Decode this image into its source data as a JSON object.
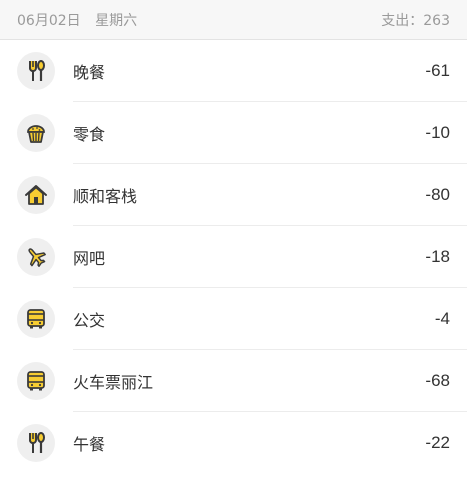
{
  "header": {
    "date": "06月02日",
    "weekday": "星期六",
    "expense_label": "支出：263"
  },
  "colors": {
    "icon_yellow": "#f7cd32",
    "icon_dark": "#3a3a3a",
    "icon_bg": "#efefef",
    "header_bg": "#f7f7f7",
    "text": "#333333",
    "muted": "#9a9a9a"
  },
  "items": [
    {
      "icon": "fork-spoon-icon",
      "category": "晚餐",
      "amount": "-61"
    },
    {
      "icon": "muffin-icon",
      "category": "零食",
      "amount": "-10"
    },
    {
      "icon": "house-icon",
      "category": "顺和客栈",
      "amount": "-80"
    },
    {
      "icon": "airplane-icon",
      "category": "网吧",
      "amount": "-18"
    },
    {
      "icon": "bus-icon",
      "category": "公交",
      "amount": "-4"
    },
    {
      "icon": "bus-icon",
      "category": "火车票丽江",
      "amount": "-68"
    },
    {
      "icon": "fork-spoon-icon",
      "category": "午餐",
      "amount": "-22"
    }
  ]
}
